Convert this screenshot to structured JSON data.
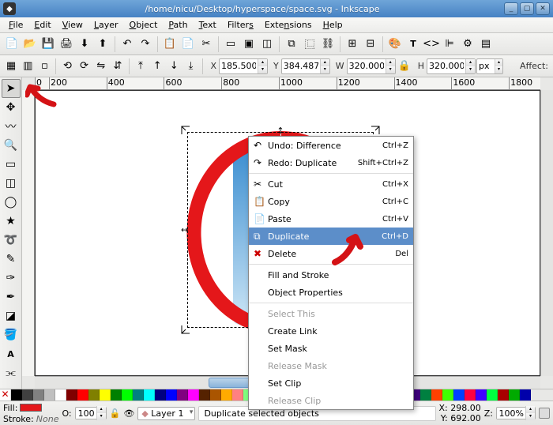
{
  "window": {
    "title": "/home/nicu/Desktop/hyperspace/space.svg - Inkscape"
  },
  "menubar": [
    "File",
    "Edit",
    "View",
    "Layer",
    "Object",
    "Path",
    "Text",
    "Filters",
    "Extensions",
    "Help"
  ],
  "tooloptions": {
    "x_label": "X",
    "x": "185.500",
    "y_label": "Y",
    "y": "384.487",
    "w_label": "W",
    "w": "320.000",
    "h_label": "H",
    "h": "320.000",
    "unit": "px",
    "affect": "Affect:"
  },
  "contextmenu": {
    "undo": {
      "label": "Undo: Difference",
      "shortcut": "Ctrl+Z"
    },
    "redo": {
      "label": "Redo: Duplicate",
      "shortcut": "Shift+Ctrl+Z"
    },
    "cut": {
      "label": "Cut",
      "shortcut": "Ctrl+X"
    },
    "copy": {
      "label": "Copy",
      "shortcut": "Ctrl+C"
    },
    "paste": {
      "label": "Paste",
      "shortcut": "Ctrl+V"
    },
    "duplicate": {
      "label": "Duplicate",
      "shortcut": "Ctrl+D"
    },
    "delete": {
      "label": "Delete",
      "shortcut": "Del"
    },
    "fillstroke": {
      "label": "Fill and Stroke"
    },
    "objprops": {
      "label": "Object Properties"
    },
    "selectthis": {
      "label": "Select This"
    },
    "createlink": {
      "label": "Create Link"
    },
    "setmask": {
      "label": "Set Mask"
    },
    "releasemask": {
      "label": "Release Mask"
    },
    "setclip": {
      "label": "Set Clip"
    },
    "releaseclip": {
      "label": "Release Clip"
    }
  },
  "status": {
    "fill_label": "Fill:",
    "stroke_label": "Stroke:",
    "stroke_none": "None",
    "opacity_label": "O:",
    "opacity": "100",
    "layer": "Layer 1",
    "message": "Duplicate selected objects",
    "x_label": "X:",
    "x": "298.00",
    "y_label": "Y:",
    "y": "692.00",
    "z_label": "Z:",
    "zoom": "100%"
  },
  "ruler_ticks": [
    "0",
    "200",
    "400",
    "600",
    "800",
    "1000",
    "1200",
    "1400",
    "1600",
    "1800"
  ],
  "palette": [
    "#000000",
    "#404040",
    "#808080",
    "#c0c0c0",
    "#ffffff",
    "#800000",
    "#ff0000",
    "#808000",
    "#ffff00",
    "#008000",
    "#00ff00",
    "#008080",
    "#00ffff",
    "#000080",
    "#0000ff",
    "#800080",
    "#ff00ff",
    "#552200",
    "#aa5500",
    "#ffaa00",
    "#ff8080",
    "#80ff80",
    "#8080ff",
    "#ffff80",
    "#80ffff",
    "#ff80ff",
    "#c04040",
    "#40c040",
    "#4040c0",
    "#c0c040",
    "#40c0c0",
    "#c040c0",
    "#804000",
    "#408000",
    "#004080",
    "#800040",
    "#400080",
    "#008040",
    "#ff4000",
    "#40ff00",
    "#0040ff",
    "#ff0040",
    "#4000ff",
    "#00ff40",
    "#aa0000",
    "#00aa00",
    "#0000aa"
  ]
}
